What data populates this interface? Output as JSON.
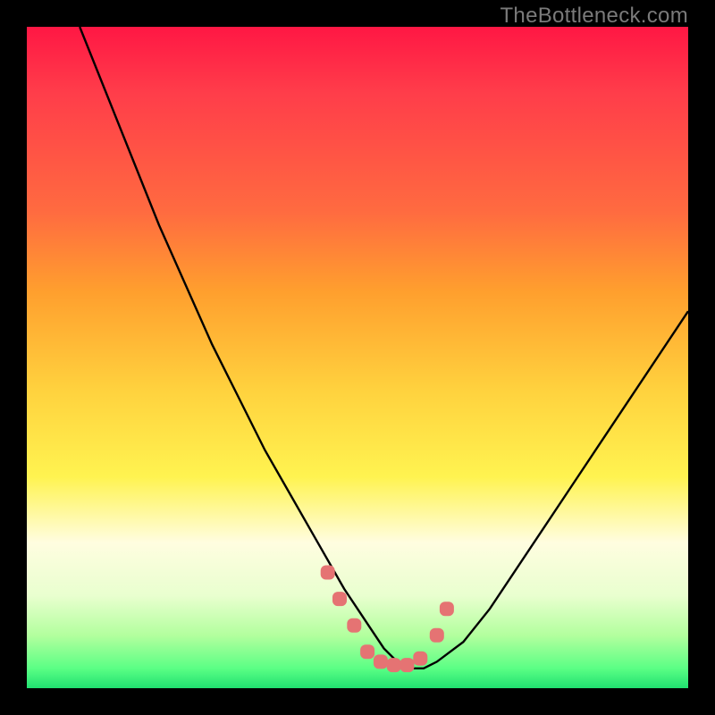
{
  "watermark": "TheBottleneck.com",
  "colors": {
    "gradient_top": "#ff1744",
    "gradient_mid": "#ffd23e",
    "gradient_bottom": "#20e070",
    "curve": "#000000",
    "marker": "#e57373",
    "frame": "#000000"
  },
  "chart_data": {
    "type": "line",
    "title": "",
    "xlabel": "",
    "ylabel": "",
    "xlim": [
      0,
      100
    ],
    "ylim": [
      0,
      100
    ],
    "grid": false,
    "legend": false,
    "note": "Axes are unlabeled; values are estimated from pixel positions as 0–100 normalized coordinates. Curve is a V-shaped bottleneck curve with minimum near x≈55.",
    "series": [
      {
        "name": "bottleneck-curve",
        "x": [
          8,
          12,
          16,
          20,
          24,
          28,
          32,
          36,
          40,
          44,
          48,
          50,
          52,
          54,
          56,
          58,
          60,
          62,
          66,
          70,
          74,
          78,
          82,
          86,
          90,
          94,
          98,
          100
        ],
        "y": [
          100,
          90,
          80,
          70,
          61,
          52,
          44,
          36,
          29,
          22,
          15,
          12,
          9,
          6,
          4,
          3,
          3,
          4,
          7,
          12,
          18,
          24,
          30,
          36,
          42,
          48,
          54,
          57
        ]
      }
    ],
    "markers": {
      "name": "highlight-dots",
      "shape": "rounded-square",
      "color": "#e57373",
      "x": [
        45.5,
        47.3,
        49.5,
        51.5,
        53.5,
        55.5,
        57.5,
        59.5,
        62.0,
        63.5
      ],
      "y": [
        17.5,
        13.5,
        9.5,
        5.5,
        4.0,
        3.5,
        3.5,
        4.5,
        8.0,
        12.0
      ]
    }
  }
}
